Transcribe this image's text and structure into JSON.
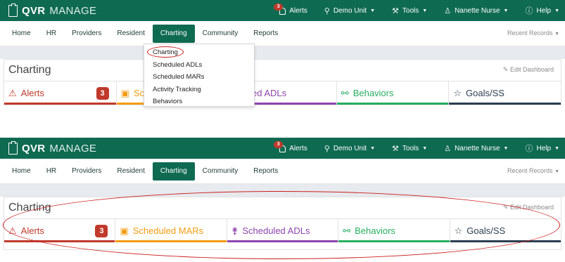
{
  "brand": {
    "strong": "QVR",
    "light": "MANAGE"
  },
  "topmenu": {
    "alerts_badge": "3",
    "alerts": "Alerts",
    "unit": "Demo Unit",
    "tools": "Tools",
    "user": "Nanette Nurse",
    "help": "Help"
  },
  "nav": [
    "Home",
    "HR",
    "Providers",
    "Resident",
    "Charting",
    "Community",
    "Reports"
  ],
  "nav_active": "Charting",
  "recent": "Recent Records",
  "page_title": "Charting",
  "edit_dashboard": "Edit Dashboard",
  "tiles": {
    "alerts": "Alerts",
    "alerts_count": "3",
    "mars": "Scheduled MARs",
    "mars_partial": "Sc",
    "adls": "Scheduled ADLs",
    "adls_partial": "heduled ADLs",
    "behaviors": "Behaviors",
    "goals": "Goals/SS"
  },
  "dropdown": [
    "Charting",
    "Scheduled ADLs",
    "Scheduled MARs",
    "Activity Tracking",
    "Behaviors"
  ],
  "colors": {
    "topbar": "#0f6a52",
    "alerts": "#c0392b",
    "mars": "#f39c12",
    "adls": "#8e44ad",
    "behaviors": "#27ae60",
    "goals": "#2c3e50",
    "annotation": "#cc1f1f"
  },
  "icons": {
    "brand": "clipboard-icon",
    "alerts": "bell-icon",
    "unit": "map-pin-icon",
    "tools": "wrench-icon",
    "user": "user-icon",
    "help": "question-circle-icon",
    "edit": "pencil-icon",
    "tile_alerts": "warning-triangle-icon",
    "tile_mars": "pill-box-icon",
    "tile_adls": "walking-person-icon",
    "tile_behaviors": "link-icon",
    "tile_goals": "star-icon"
  }
}
